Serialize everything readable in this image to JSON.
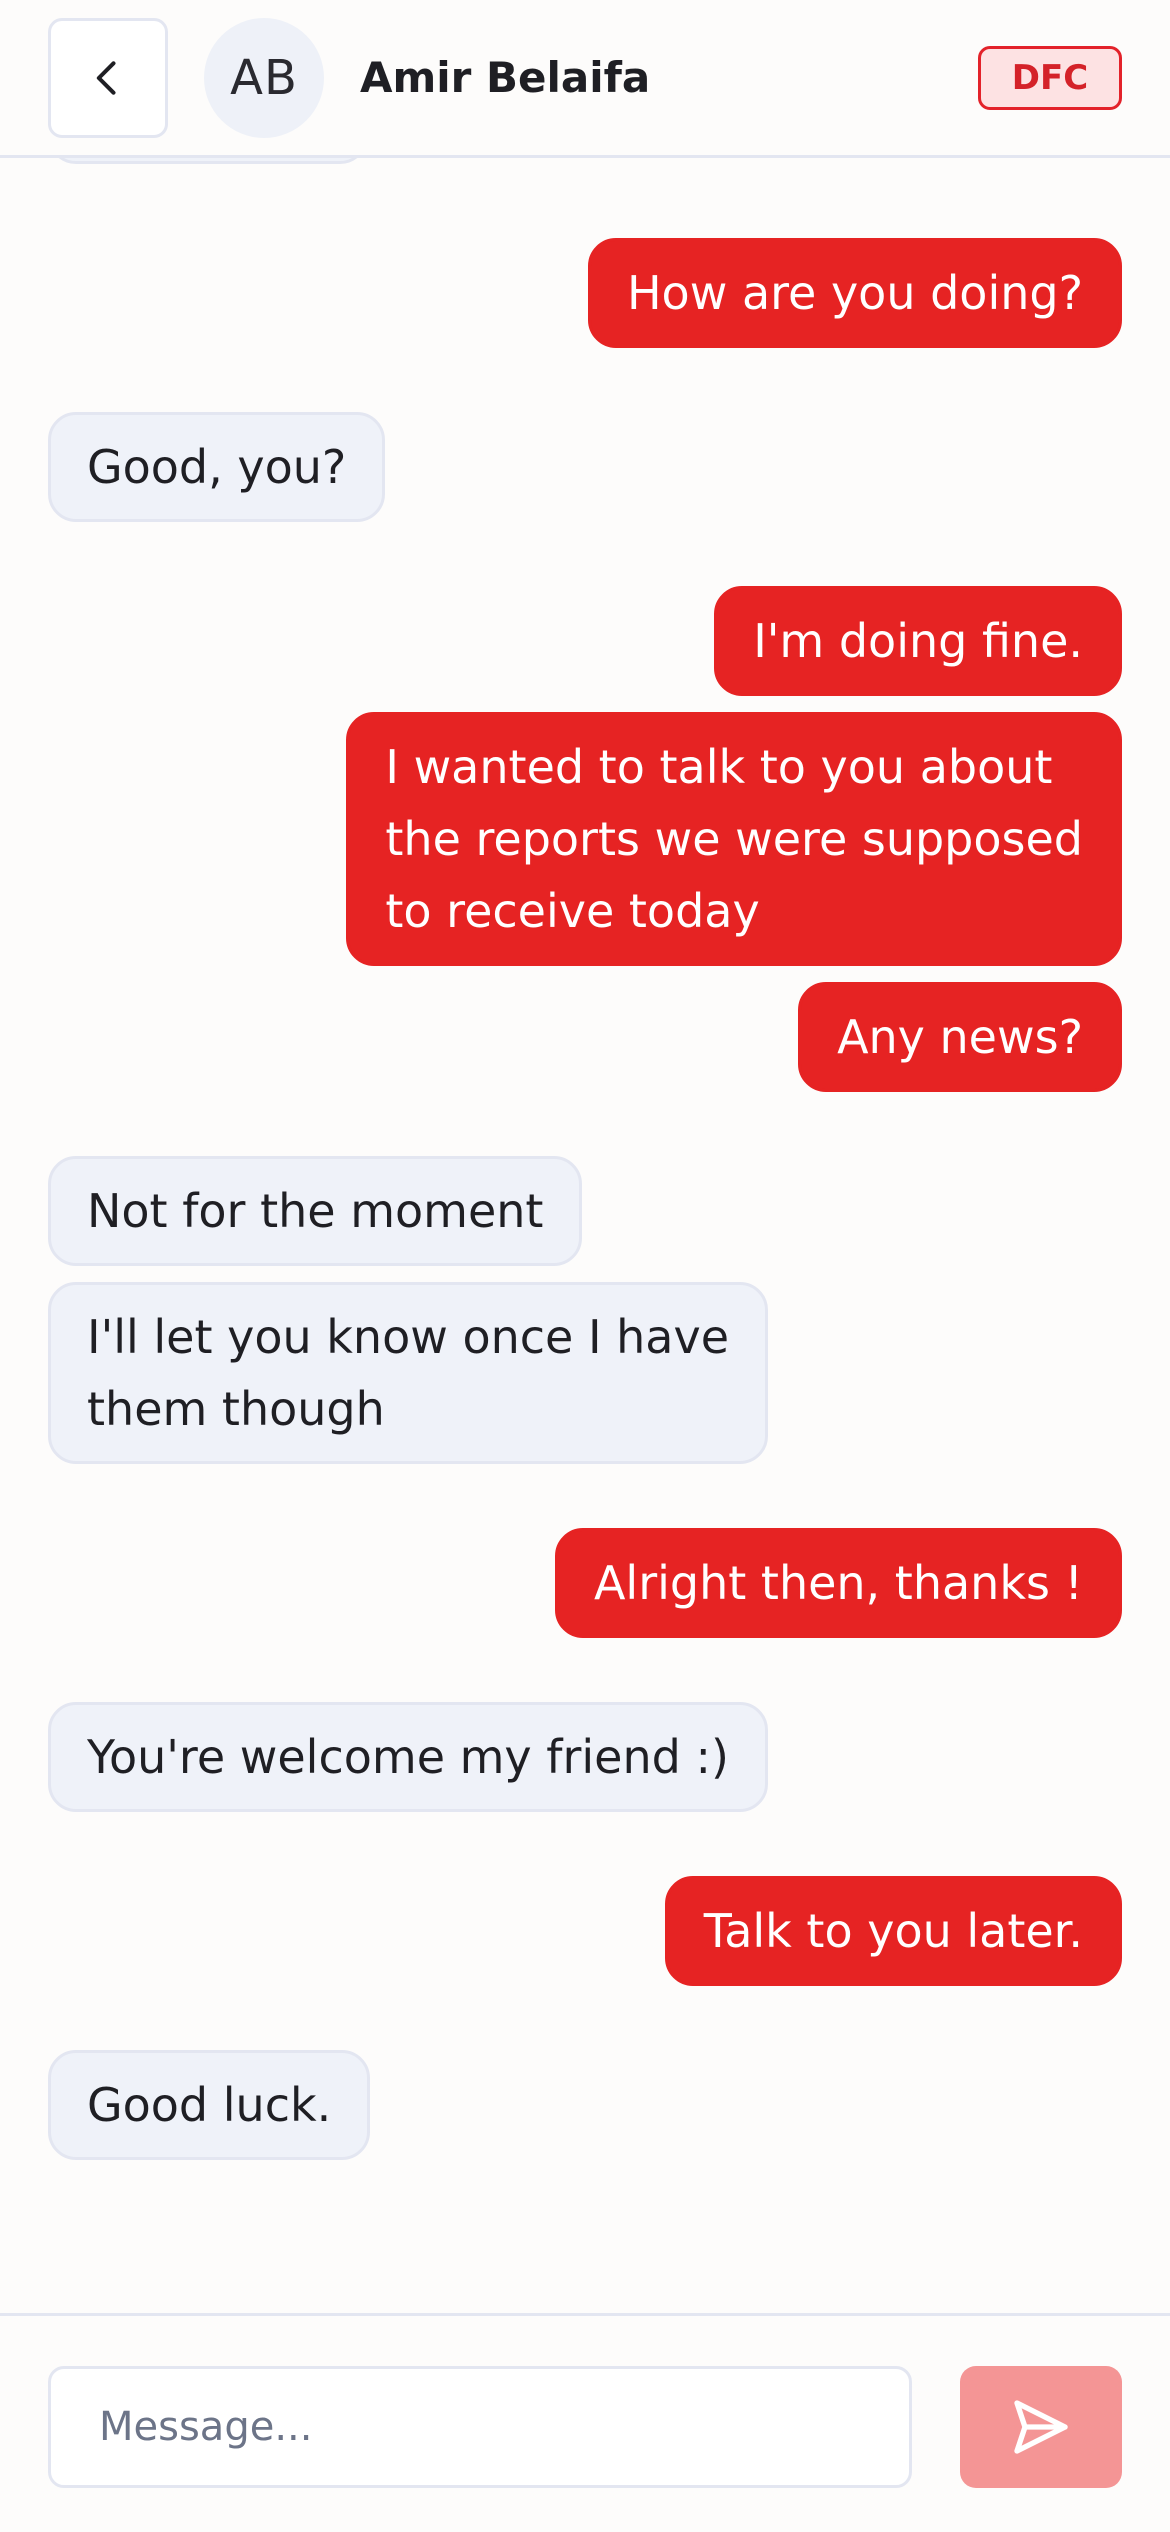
{
  "header": {
    "avatar_initials": "AB",
    "contact_name": "Amir Belaifa",
    "badge": "DFC",
    "back_icon": "chevron-left-icon"
  },
  "colors": {
    "outgoing_bubble": "#e62323",
    "incoming_bubble": "#eff2f9",
    "badge_bg": "#fde2e3",
    "send_button": "#f49595"
  },
  "messages": [
    {
      "from": "contact",
      "text": ""
    },
    {
      "from": "me",
      "text": "How are you doing?"
    },
    {
      "from": "contact",
      "text": "Good, you?"
    },
    {
      "from": "me",
      "text": "I'm doing fine."
    },
    {
      "from": "me",
      "text": "I wanted to talk to you about\nthe reports we were supposed\nto receive today"
    },
    {
      "from": "me",
      "text": "Any news?"
    },
    {
      "from": "contact",
      "text": "Not for the moment"
    },
    {
      "from": "contact",
      "text": "I'll let you know once I have\nthem though"
    },
    {
      "from": "me",
      "text": "Alright then, thanks !"
    },
    {
      "from": "contact",
      "text": "You're welcome my friend :)"
    },
    {
      "from": "me",
      "text": "Talk to you later."
    },
    {
      "from": "contact",
      "text": "Good luck."
    }
  ],
  "composer": {
    "placeholder": "Message...",
    "value": "",
    "send_icon": "send-icon"
  }
}
